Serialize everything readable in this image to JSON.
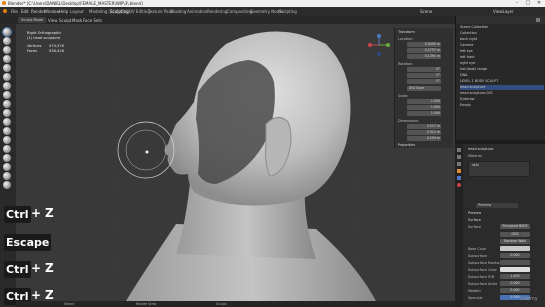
{
  "titlebar": {
    "title": "Blender* [C:\\Users\\DANIEL\\Desktop\\FEMALE_MASTER\\WIP\\3\\.blend]",
    "btn_min": "–",
    "btn_max": "□",
    "btn_close": "✕"
  },
  "menubar": {
    "menus": [
      "File",
      "Edit",
      "Render",
      "Window",
      "Help"
    ],
    "workspaces": [
      "Layout",
      "Modeling",
      "Sculpting",
      "UV Editing",
      "Texture Paint",
      "Shading",
      "Animation",
      "Rendering",
      "Compositing",
      "Geometry Nodes",
      "Scripting"
    ],
    "active_workspace": "Sculpting",
    "scene": "Scene",
    "view_layer": "ViewLayer"
  },
  "header": {
    "mode": "Sculpt Mode",
    "items": [
      "View",
      "Sculpt",
      "Mask",
      "Face Sets"
    ]
  },
  "viewport": {
    "view_name": "Right Orthographic",
    "collection": "(1) head sculpture",
    "vertices_label": "Vertices",
    "vertices": "474,576",
    "faces_label": "Faces",
    "faces": "938,418"
  },
  "npanel": {
    "section": "Transform",
    "location_label": "Location:",
    "location": [
      "0.0000 m",
      "0.2757 m",
      "0.1391 m"
    ],
    "rotation_label": "Rotation:",
    "rotation": [
      "0°",
      "0°",
      "0°"
    ],
    "rotation_mode": "XYZ Euler",
    "scale_label": "Scale:",
    "scale": [
      "1.000",
      "1.000",
      "1.000"
    ],
    "dimensions_label": "Dimensions:",
    "dimensions": [
      "0.217 m",
      "0.312 m",
      "0.294 m"
    ],
    "properties_label": "Properties"
  },
  "outliner": {
    "title": "Scene Collection",
    "items": [
      {
        "name": "Collection",
        "selected": false
      },
      {
        "name": "back right",
        "selected": false
      },
      {
        "name": "Camera",
        "selected": false
      },
      {
        "name": "left eye",
        "selected": false
      },
      {
        "name": "left front",
        "selected": false
      },
      {
        "name": "right eye",
        "selected": false
      },
      {
        "name": "hair/body range",
        "selected": false
      },
      {
        "name": "DNA",
        "selected": false
      },
      {
        "name": "LEVEL 1 BODY SCULPT",
        "selected": false
      },
      {
        "name": "head sculpture",
        "selected": true
      },
      {
        "name": "head sculpture.001",
        "selected": false
      },
      {
        "name": "Eyebrow",
        "selected": false
      },
      {
        "name": "Empty",
        "selected": false
      }
    ]
  },
  "properties": {
    "object": "head sculpture",
    "material_slot": "Material",
    "material": "skin",
    "material_name": "Preview",
    "sections": [
      "Preview",
      "Surface"
    ],
    "surface_label": "Surface",
    "surface": "Principled BSDF",
    "rows": [
      {
        "label": "Base Color",
        "value": ""
      },
      {
        "label": "Subsurface",
        "value": "0.000"
      },
      {
        "label": "Subsurface Radius",
        "value": ""
      },
      {
        "label": "Subsurface Color",
        "value": ""
      },
      {
        "label": "Subsurface IOR",
        "value": "1.400"
      },
      {
        "label": "Subsurface Aniso",
        "value": "0.000"
      },
      {
        "label": "Metallic",
        "value": "0.000"
      },
      {
        "label": "Specular",
        "value": "0.500"
      }
    ],
    "values_top": [
      "GGX",
      "Random Walk"
    ]
  },
  "keys": [
    {
      "label": "Ctrl",
      "plus": "+",
      "key": "Z"
    },
    {
      "label": "Escape"
    },
    {
      "label": "Ctrl",
      "plus": "+",
      "key": "Z"
    },
    {
      "label": "Ctrl",
      "plus": "+",
      "key": "Z"
    }
  ],
  "status": {
    "left": "Select",
    "middle": "Rotate View",
    "right": "Sculpt",
    "watermark": "Udemy"
  },
  "colors": {
    "accent": "#4772b3",
    "viewport": "#393939",
    "mesh": "#c9c9c9",
    "mask": "#4a4a4a"
  }
}
